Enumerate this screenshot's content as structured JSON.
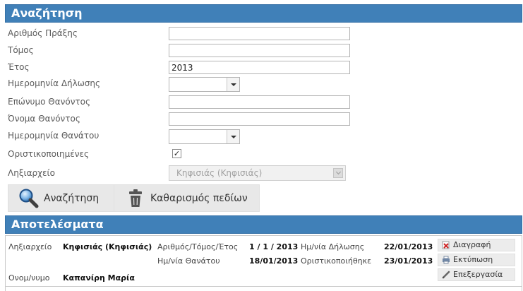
{
  "search": {
    "header": "Αναζήτηση",
    "fields": {
      "act_number_label": "Αριθμός Πράξης",
      "act_number_value": "",
      "volume_label": "Τόμος",
      "volume_value": "",
      "year_label": "Έτος",
      "year_value": "2013",
      "declaration_date_label": "Ημερομηνία Δήλωσης",
      "declaration_date_value": "",
      "surname_label": "Επώνυμο Θανόντος",
      "surname_value": "",
      "name_label": "Όνομα Θανόντος",
      "name_value": "",
      "death_date_label": "Ημερομηνία Θανάτου",
      "death_date_value": "",
      "finalized_label": "Οριστικοποιημένες",
      "finalized_checked": "✓",
      "registry_label": "Ληξιαρχείο",
      "registry_value": "Κηφισιάς (Κηφισιάς)"
    },
    "buttons": {
      "search_label": "Αναζήτηση",
      "clear_label": "Καθαρισμός πεδίων"
    }
  },
  "results": {
    "header": "Αποτελέσματα",
    "row": {
      "registry_label": "Ληξιαρχείο",
      "registry_value": "Κηφισιάς (Κηφισιάς)",
      "number_label": "Αριθμός/Τόμος/Έτος",
      "number_value": "1 / 1 / 2013",
      "declaration_label": "Ημ/νία Δήλωσης",
      "declaration_value": "22/01/2013",
      "death_label": "Ημ/νία Θανάτου",
      "death_value": "18/01/2013",
      "finalized_label": "Οριστικοποιήθηκε",
      "finalized_value": "23/01/2013",
      "name_label": "Ονομ/νυμο",
      "name_value": "Καπανίρη Μαρία"
    },
    "actions": {
      "delete_label": "Διαγραφή",
      "print_label": "Εκτύπωση",
      "edit_label": "Επεξεργασία"
    }
  },
  "colors": {
    "header_bg": "#4080b8",
    "button_bg": "#e8e8e8"
  }
}
